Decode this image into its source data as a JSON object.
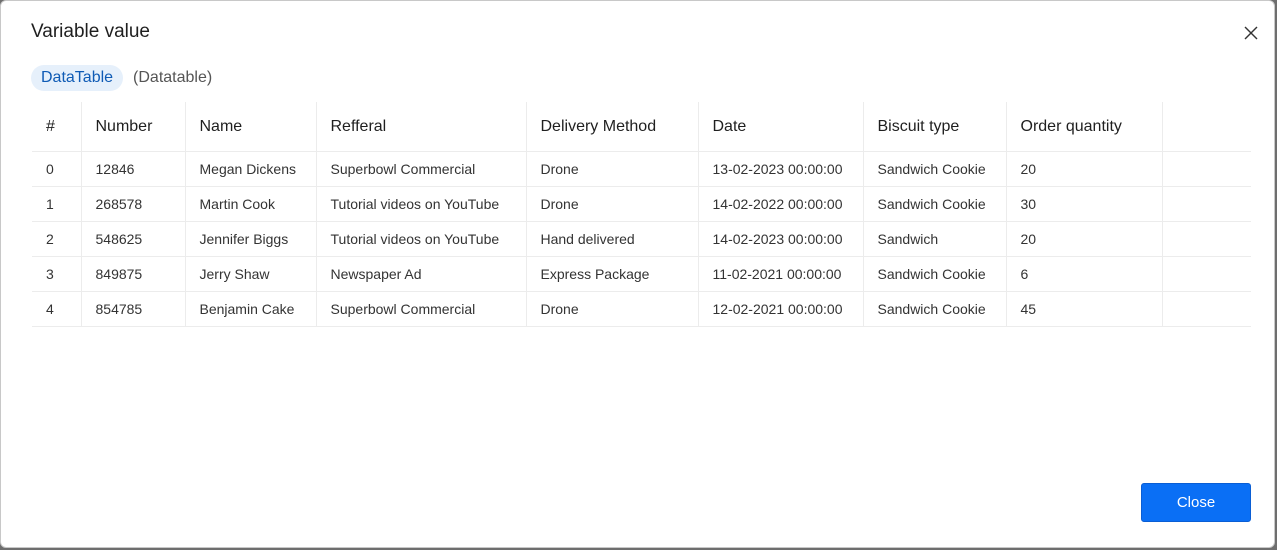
{
  "dialog": {
    "title": "Variable value",
    "close_icon": "close-icon"
  },
  "variable": {
    "name": "DataTable",
    "type": "(Datatable)"
  },
  "table": {
    "columns": [
      "#",
      "Number",
      "Name",
      "Refferal",
      "Delivery Method",
      "Date",
      "Biscuit type",
      "Order quantity"
    ],
    "rows": [
      [
        "0",
        "12846",
        "Megan Dickens",
        "Superbowl Commercial",
        "Drone",
        "13-02-2023 00:00:00",
        "Sandwich Cookie",
        "20"
      ],
      [
        "1",
        "268578",
        "Martin Cook",
        "Tutorial videos on YouTube",
        "Drone",
        "14-02-2022 00:00:00",
        "Sandwich Cookie",
        "30"
      ],
      [
        "2",
        "548625",
        "Jennifer Biggs",
        "Tutorial videos on YouTube",
        "Hand delivered",
        "14-02-2023 00:00:00",
        "Sandwich",
        "20"
      ],
      [
        "3",
        "849875",
        "Jerry Shaw",
        "Newspaper Ad",
        "Express Package",
        "11-02-2021 00:00:00",
        "Sandwich Cookie",
        "6"
      ],
      [
        "4",
        "854785",
        "Benjamin Cake",
        "Superbowl Commercial",
        "Drone",
        "12-02-2021 00:00:00",
        "Sandwich Cookie",
        "45"
      ]
    ]
  },
  "footer": {
    "close_label": "Close"
  },
  "colors": {
    "accent": "#0a6ff5",
    "pill_bg": "#e6f0fb",
    "pill_text": "#0f5bb5"
  }
}
